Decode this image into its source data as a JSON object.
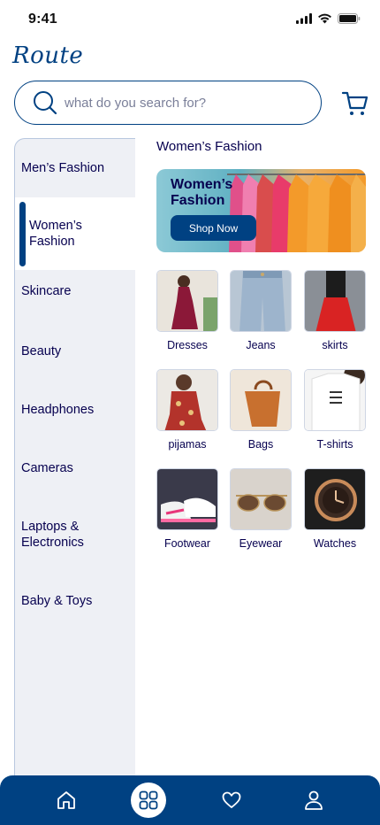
{
  "status": {
    "time": "9:41"
  },
  "brand": {
    "logo": "Route"
  },
  "search": {
    "placeholder": "what do you search for?"
  },
  "sidebar": {
    "items": [
      {
        "label": "Men’s Fashion"
      },
      {
        "label": "Women’s Fashion"
      },
      {
        "label": "Skincare"
      },
      {
        "label": "Beauty"
      },
      {
        "label": "Headphones"
      },
      {
        "label": "Cameras"
      },
      {
        "label": "Laptops & Electronics"
      },
      {
        "label": "Baby & Toys"
      }
    ],
    "active_index": 1
  },
  "main": {
    "title": "Women’s Fashion",
    "banner": {
      "title": "Women’s Fashion",
      "button": "Shop Now"
    },
    "subcategories": [
      {
        "label": "Dresses",
        "icon": "dress-photo"
      },
      {
        "label": "Jeans",
        "icon": "jeans-photo"
      },
      {
        "label": "skirts",
        "icon": "skirt-photo"
      },
      {
        "label": "pijamas",
        "icon": "pajamas-photo"
      },
      {
        "label": "Bags",
        "icon": "bag-photo"
      },
      {
        "label": "T-shirts",
        "icon": "tshirt-photo"
      },
      {
        "label": "Footwear",
        "icon": "sneakers-photo"
      },
      {
        "label": "Eyewear",
        "icon": "sunglasses-photo"
      },
      {
        "label": "Watches",
        "icon": "watch-photo"
      }
    ]
  },
  "nav": {
    "items": [
      {
        "icon": "home-icon"
      },
      {
        "icon": "categories-icon",
        "active": true
      },
      {
        "icon": "heart-icon"
      },
      {
        "icon": "profile-icon"
      }
    ]
  },
  "colors": {
    "primary": "#004182",
    "text": "#06004f",
    "sidebar_bg": "#eef0f5"
  }
}
